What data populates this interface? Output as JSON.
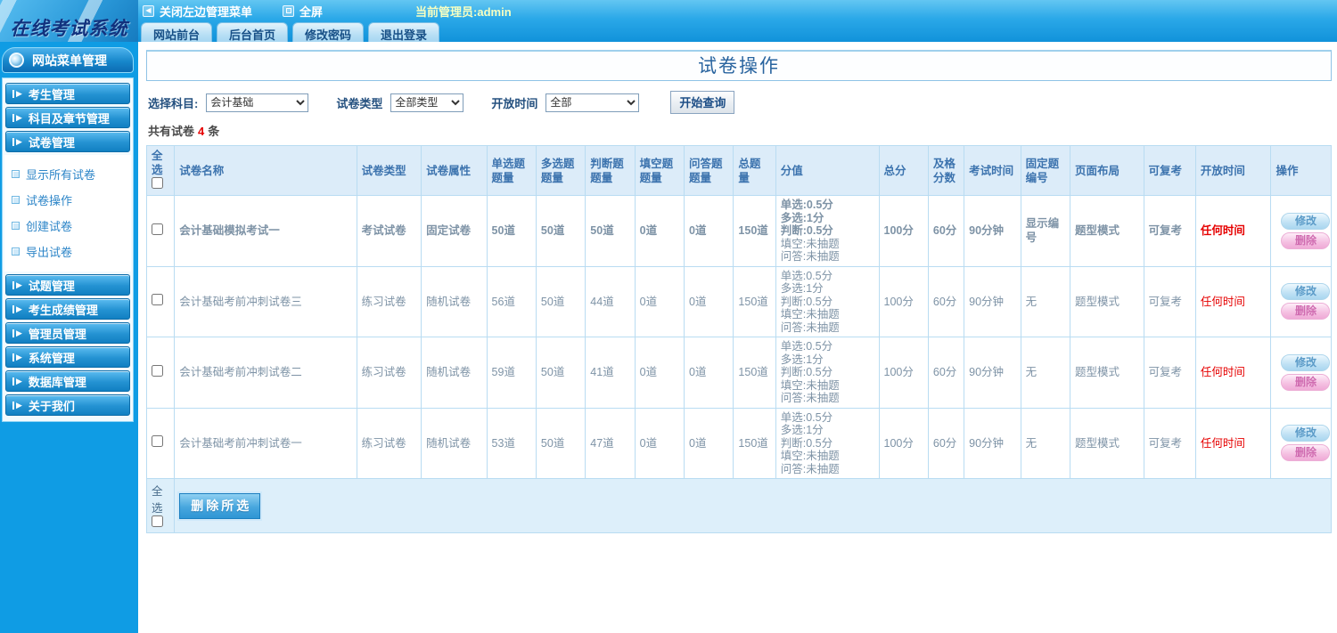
{
  "header": {
    "logo": "在线考试系统",
    "close_menu": "关闭左边管理菜单",
    "fullscreen": "全屏",
    "admin_label": "当前管理员:admin",
    "tabs": [
      "网站前台",
      "后台首页",
      "修改密码",
      "退出登录"
    ]
  },
  "sidebar": {
    "title": "网站菜单管理",
    "items_top": [
      "考生管理",
      "科目及章节管理",
      "试卷管理"
    ],
    "submenu": [
      "显示所有试卷",
      "试卷操作",
      "创建试卷",
      "导出试卷"
    ],
    "items_bottom": [
      "试题管理",
      "考生成绩管理",
      "管理员管理",
      "系统管理",
      "数据库管理",
      "关于我们"
    ]
  },
  "main": {
    "page_title": "试卷操作",
    "filters": {
      "subject_label": "选择科目:",
      "subject_value": "会计基础",
      "type_label": "试卷类型",
      "type_value": "全部类型",
      "time_label": "开放时间",
      "time_value": "全部",
      "search_button": "开始查询"
    },
    "count": {
      "prefix": "共有试卷",
      "value": "4",
      "suffix": "条"
    },
    "table": {
      "headers": [
        "全选",
        "试卷名称",
        "试卷类型",
        "试卷属性",
        "单选题题量",
        "多选题题量",
        "判断题题量",
        "填空题题量",
        "问答题题量",
        "总题量",
        "分值",
        "总分",
        "及格分数",
        "考试时间",
        "固定题编号",
        "页面布局",
        "可复考",
        "开放时间",
        "操作"
      ],
      "rows": [
        {
          "name": "会计基础模拟考试一",
          "type": "考试试卷",
          "attr": "固定试卷",
          "single": "50道",
          "multi": "50道",
          "judge": "50道",
          "blank": "0道",
          "qa": "0道",
          "total": "150道",
          "scores": [
            "单选:0.5分",
            "多选:1分",
            "判断:0.5分",
            "填空:未抽题",
            "问答:未抽题"
          ],
          "total_score": "100分",
          "pass_score": "60分",
          "exam_time": "90分钟",
          "fixed_no": "显示编号",
          "layout": "题型模式",
          "retake": "可复考",
          "open_time": "任何时间",
          "bold": true
        },
        {
          "name": "会计基础考前冲刺试卷三",
          "type": "练习试卷",
          "attr": "随机试卷",
          "single": "56道",
          "multi": "50道",
          "judge": "44道",
          "blank": "0道",
          "qa": "0道",
          "total": "150道",
          "scores": [
            "单选:0.5分",
            "多选:1分",
            "判断:0.5分",
            "填空:未抽题",
            "问答:未抽题"
          ],
          "total_score": "100分",
          "pass_score": "60分",
          "exam_time": "90分钟",
          "fixed_no": "无",
          "layout": "题型模式",
          "retake": "可复考",
          "open_time": "任何时间",
          "bold": false
        },
        {
          "name": "会计基础考前冲刺试卷二",
          "type": "练习试卷",
          "attr": "随机试卷",
          "single": "59道",
          "multi": "50道",
          "judge": "41道",
          "blank": "0道",
          "qa": "0道",
          "total": "150道",
          "scores": [
            "单选:0.5分",
            "多选:1分",
            "判断:0.5分",
            "填空:未抽题",
            "问答:未抽题"
          ],
          "total_score": "100分",
          "pass_score": "60分",
          "exam_time": "90分钟",
          "fixed_no": "无",
          "layout": "题型模式",
          "retake": "可复考",
          "open_time": "任何时间",
          "bold": false
        },
        {
          "name": "会计基础考前冲刺试卷一",
          "type": "练习试卷",
          "attr": "随机试卷",
          "single": "53道",
          "multi": "50道",
          "judge": "47道",
          "blank": "0道",
          "qa": "0道",
          "total": "150道",
          "scores": [
            "单选:0.5分",
            "多选:1分",
            "判断:0.5分",
            "填空:未抽题",
            "问答:未抽题"
          ],
          "total_score": "100分",
          "pass_score": "60分",
          "exam_time": "90分钟",
          "fixed_no": "无",
          "layout": "题型模式",
          "retake": "可复考",
          "open_time": "任何时间",
          "bold": false
        }
      ],
      "actions": {
        "edit": "修改",
        "delete": "删除"
      },
      "footer": {
        "select_all": "全选",
        "delete_selected": "删除所选"
      }
    }
  }
}
